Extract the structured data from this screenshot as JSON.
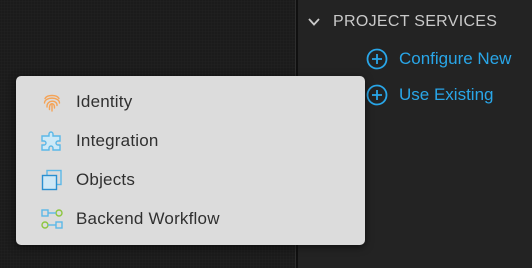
{
  "right_panel": {
    "section_title": "PROJECT SERVICES",
    "actions": [
      {
        "label": "Configure New",
        "icon": "plus-circle-icon"
      },
      {
        "label": "Use Existing",
        "icon": "plus-circle-icon"
      }
    ]
  },
  "menu": {
    "items": [
      {
        "label": "Identity",
        "icon": "fingerprint-icon"
      },
      {
        "label": "Integration",
        "icon": "puzzle-icon"
      },
      {
        "label": "Objects",
        "icon": "objects-icon"
      },
      {
        "label": "Backend Workflow",
        "icon": "workflow-icon"
      }
    ]
  },
  "colors": {
    "accent": "#29a6e8",
    "identity_icon": "#f5a356",
    "integration_icon": "#5bb8e8",
    "workflow_icon": "#8cc63f",
    "menu_bg": "#dcdcdc"
  }
}
